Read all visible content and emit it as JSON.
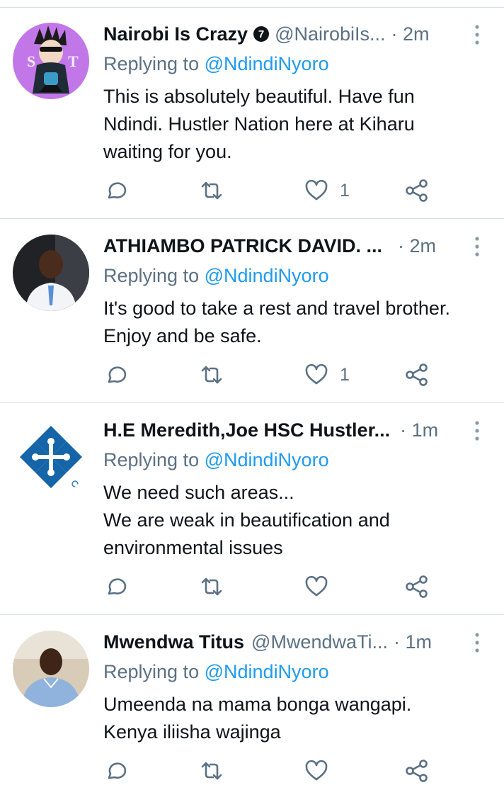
{
  "tweets": [
    {
      "name": "Nairobi Is Crazy",
      "verified_badge": "7",
      "handle": "@NairobiIs...",
      "time": "· 2m",
      "reply_prefix": "Replying to",
      "reply_to": "@NdindiNyoro",
      "body": [
        "This is absolutely beautiful. Have fun",
        "Ndindi. Hustler Nation here at Kiharu",
        "waiting for you."
      ],
      "likes": "1",
      "avatar_bg": "#c277e8"
    },
    {
      "name": "ATHIAMBO PATRICK DAVID. ...",
      "handle": "",
      "time": "· 2m",
      "reply_prefix": "Replying to",
      "reply_to": "@NdindiNyoro",
      "body": [
        "It's good to take a rest and travel brother.",
        "Enjoy and be safe."
      ],
      "likes": "1",
      "avatar_bg": "#202225"
    },
    {
      "name": "H.E Meredith,Joe HSC Hustler...",
      "handle": "",
      "time": "· 1m",
      "reply_prefix": "Replying to",
      "reply_to": "@NdindiNyoro",
      "body": [
        "We need such areas...",
        "We are weak in beautification and",
        "environmental issues"
      ],
      "likes": "",
      "avatar_bg": "#ffffff"
    },
    {
      "name": "Mwendwa Titus",
      "handle": "@MwendwaTi...",
      "time": "· 1m",
      "reply_prefix": "Replying to",
      "reply_to": "@NdindiNyoro",
      "body": [
        "Umeenda na mama bonga wangapi.",
        "Kenya iliisha wajinga"
      ],
      "likes": "",
      "avatar_bg": "#c9b9a6"
    }
  ],
  "icons": {
    "reply": "reply-icon",
    "retweet": "retweet-icon",
    "like": "like-icon",
    "share": "share-icon",
    "more": "more-vertical-icon",
    "verified": "verified-badge-icon"
  },
  "colors": {
    "text": "#0f1419",
    "secondary": "#5b7083",
    "link": "#1d9bf0",
    "divider": "#d9dee2",
    "logo_blue": "#1565a8"
  }
}
